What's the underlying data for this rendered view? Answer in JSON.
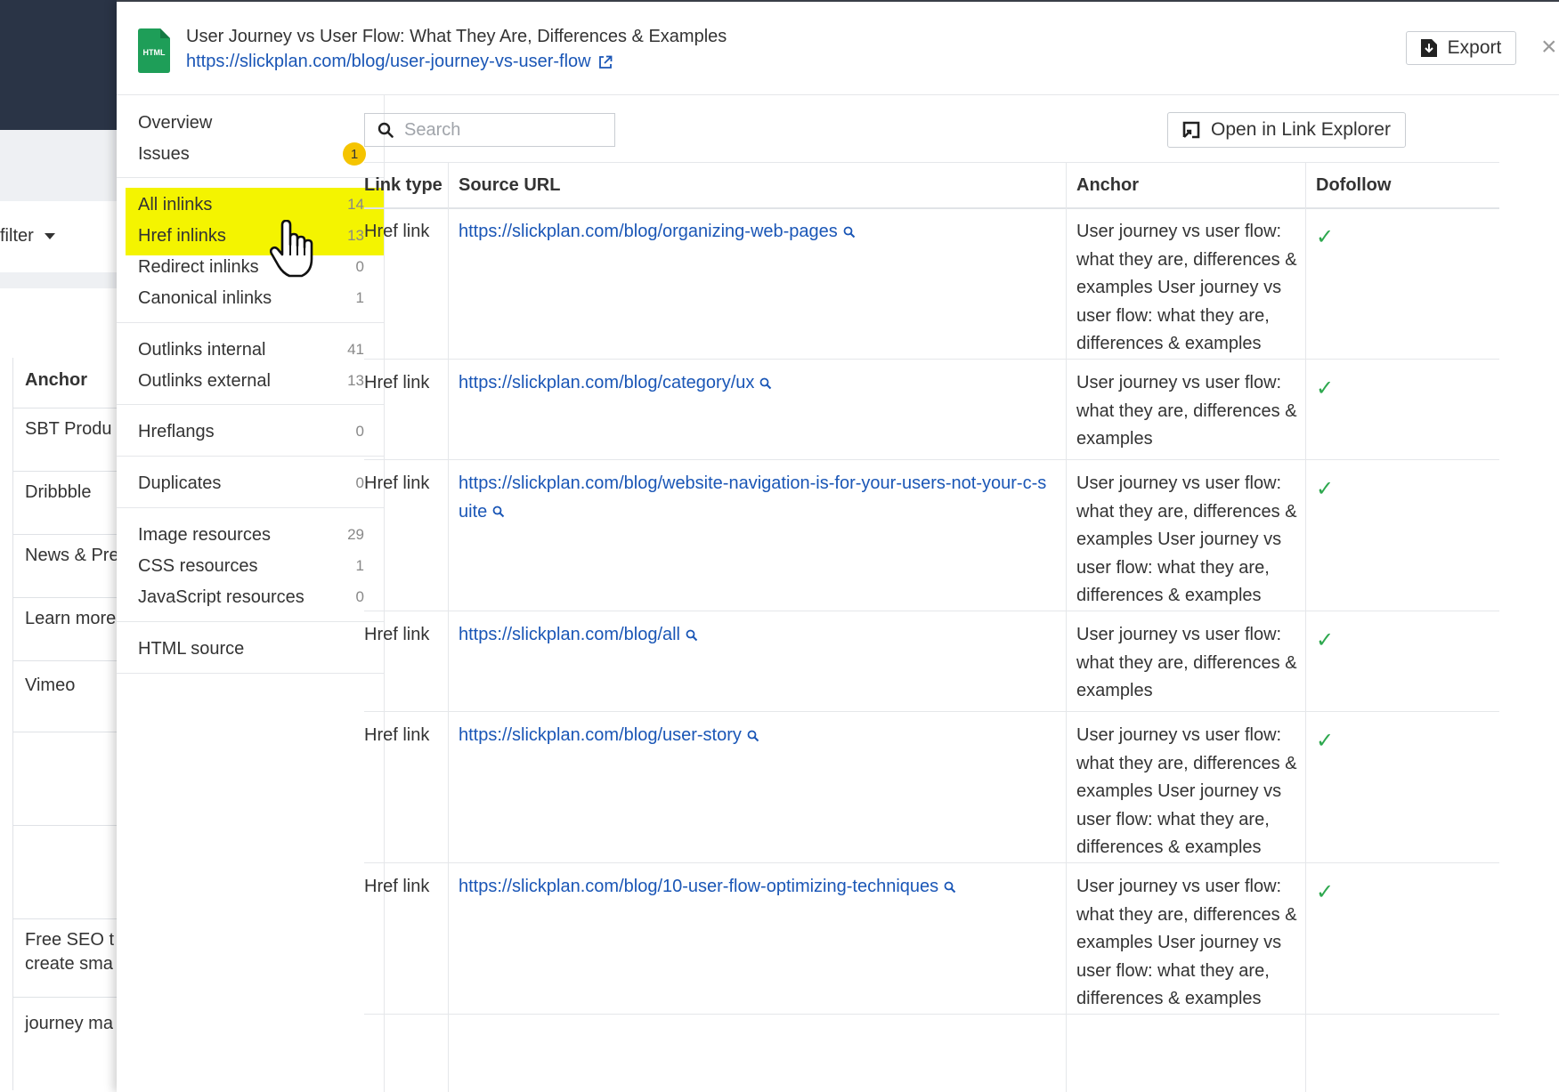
{
  "background": {
    "filter_label": "filter",
    "anchor_header": "Anchor",
    "rows": [
      "SBT Produ",
      "Dribbble",
      "News & Pre",
      "Learn more",
      "Vimeo",
      "",
      "",
      "Free SEO t\ncreate sma",
      "journey ma"
    ]
  },
  "header": {
    "file_type": "HTML",
    "title": "User Journey vs User Flow: What They Are, Differences & Examples",
    "url": "https://slickplan.com/blog/user-journey-vs-user-flow",
    "export_label": "Export",
    "close_label": "×"
  },
  "sidebar": {
    "items": [
      {
        "label": "Overview",
        "count": ""
      },
      {
        "label": "Issues",
        "count": "1"
      },
      {
        "label": "All inlinks",
        "count": "14"
      },
      {
        "label": "Href inlinks",
        "count": "13"
      },
      {
        "label": "Redirect inlinks",
        "count": "0"
      },
      {
        "label": "Canonical inlinks",
        "count": "1"
      },
      {
        "label": "Outlinks internal",
        "count": "41"
      },
      {
        "label": "Outlinks external",
        "count": "13"
      },
      {
        "label": "Hreflangs",
        "count": "0"
      },
      {
        "label": "Duplicates",
        "count": "0"
      },
      {
        "label": "Image resources",
        "count": "29"
      },
      {
        "label": "CSS resources",
        "count": "1"
      },
      {
        "label": "JavaScript resources",
        "count": "0"
      },
      {
        "label": "HTML source",
        "count": ""
      }
    ]
  },
  "toolbar": {
    "search_placeholder": "Search",
    "open_link_explorer": "Open in Link Explorer"
  },
  "table": {
    "headers": [
      "Link type",
      "Source URL",
      "Anchor",
      "Dofollow"
    ],
    "rows": [
      {
        "type": "Href link",
        "url": "https://slickplan.com/blog/organizing-web-pages",
        "anchor": "User journey vs user flow: what they are, differences & examples User journey vs user flow: what they are, differences & examples",
        "dofollow": "✓"
      },
      {
        "type": "Href link",
        "url": "https://slickplan.com/blog/category/ux",
        "anchor": "User journey vs user flow: what they are, differences & examples",
        "dofollow": "✓"
      },
      {
        "type": "Href link",
        "url": "https://slickplan.com/blog/website-navigation-is-for-your-users-not-your-c-suite",
        "anchor": "User journey vs user flow: what they are, differences & examples User journey vs user flow: what they are, differences & examples",
        "dofollow": "✓"
      },
      {
        "type": "Href link",
        "url": "https://slickplan.com/blog/all",
        "anchor": "User journey vs user flow: what they are, differences & examples",
        "dofollow": "✓"
      },
      {
        "type": "Href link",
        "url": "https://slickplan.com/blog/user-story",
        "anchor": "User journey vs user flow: what they are, differences & examples User journey vs user flow: what they are, differences & examples",
        "dofollow": "✓"
      },
      {
        "type": "Href link",
        "url": "https://slickplan.com/blog/10-user-flow-optimizing-techniques",
        "anchor": "User journey vs user flow: what they are, differences & examples User journey vs user flow: what they are, differences & examples",
        "dofollow": "✓"
      }
    ]
  },
  "colors": {
    "link": "#1a56b6",
    "highlight": "#f4f400",
    "badge": "#f5c400",
    "check": "#2ea84f",
    "file_icon": "#1e9e58",
    "navy": "#2a3446"
  }
}
